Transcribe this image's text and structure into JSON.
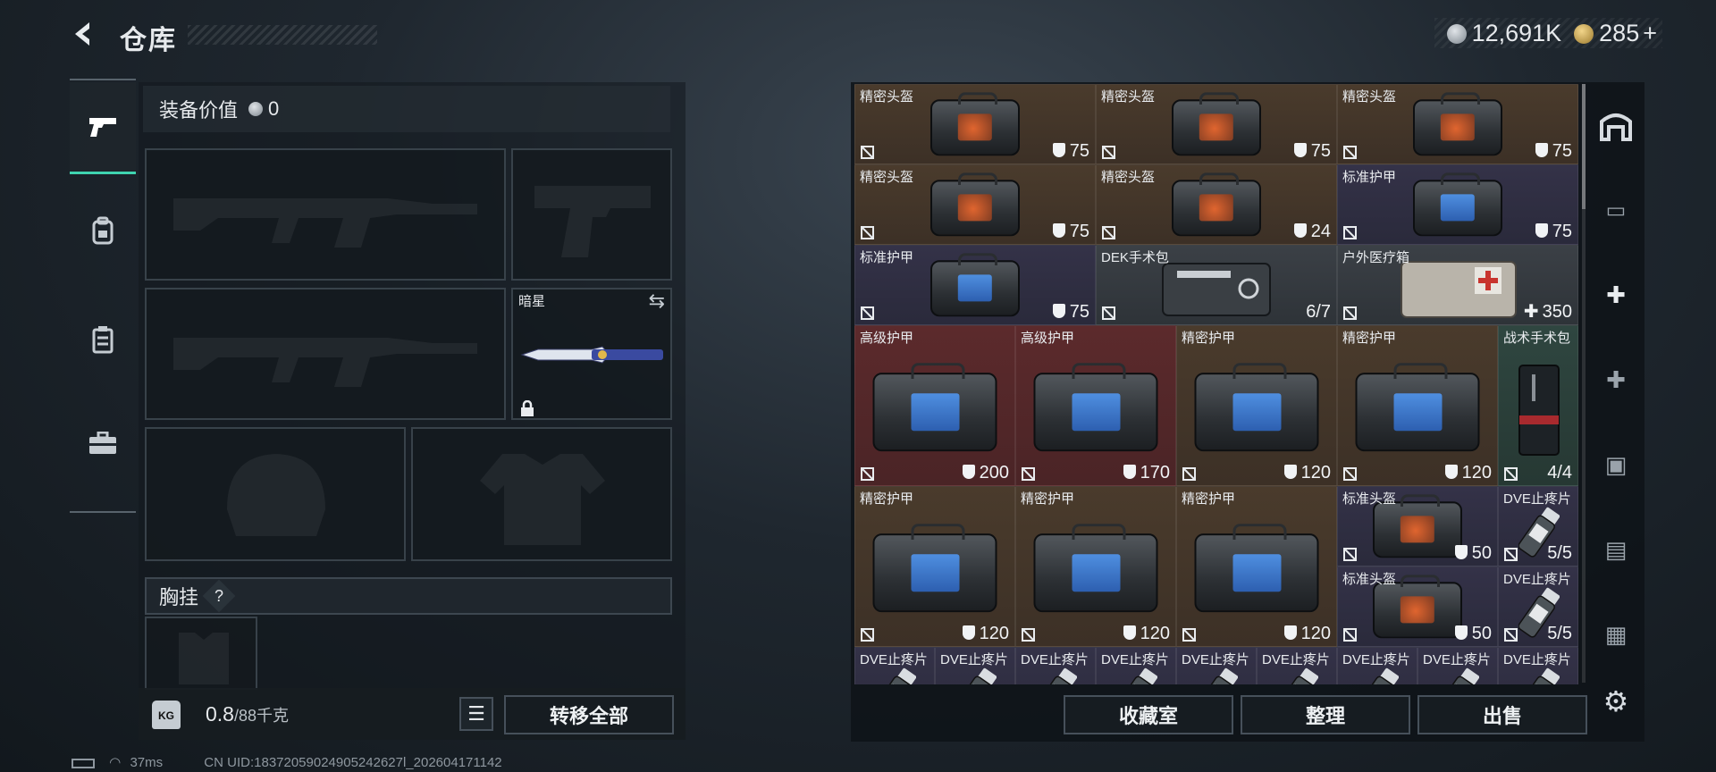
{
  "header": {
    "title": "仓库"
  },
  "currency": {
    "coins": "12,691K",
    "premium": "285",
    "premium_add": "+"
  },
  "equipment": {
    "value_label": "装备价值",
    "value": "0",
    "knife_name": "暗星",
    "chest_label": "胸挂",
    "chest_help": "?"
  },
  "footer": {
    "weight_current": "0.8",
    "weight_max": "/88千克",
    "weight_icon_text": "KG",
    "transfer_all": "转移全部",
    "collection": "收藏室",
    "organize": "整理",
    "sell": "出售"
  },
  "inventory": [
    {
      "name": "精密头盔",
      "value": "75",
      "kind": "shield",
      "color": "brown",
      "art": "helmet"
    },
    {
      "name": "精密头盔",
      "value": "75",
      "kind": "shield",
      "color": "brown",
      "art": "helmet"
    },
    {
      "name": "精密头盔",
      "value": "75",
      "kind": "shield",
      "color": "brown",
      "art": "helmet"
    },
    {
      "name": "精密头盔",
      "value": "75",
      "kind": "shield",
      "color": "brown",
      "art": "helmet"
    },
    {
      "name": "精密头盔",
      "value": "24",
      "kind": "shield",
      "color": "brown",
      "art": "helmet"
    },
    {
      "name": "标准护甲",
      "value": "75",
      "kind": "shield",
      "color": "purple",
      "art": "armor"
    },
    {
      "name": "标准护甲",
      "value": "75",
      "kind": "shield",
      "color": "purple",
      "art": "armor"
    },
    {
      "name": "DEK手术包",
      "value": "6/7",
      "kind": "count",
      "color": "gray",
      "art": "kit"
    },
    {
      "name": "户外医疗箱",
      "value": "350",
      "kind": "heal",
      "color": "gray",
      "art": "medbox"
    },
    {
      "name": "高级护甲",
      "value": "200",
      "kind": "shield",
      "color": "red",
      "art": "armor"
    },
    {
      "name": "高级护甲",
      "value": "170",
      "kind": "shield",
      "color": "red",
      "art": "armor"
    },
    {
      "name": "精密护甲",
      "value": "120",
      "kind": "shield",
      "color": "brown",
      "art": "armor"
    },
    {
      "name": "精密护甲",
      "value": "120",
      "kind": "shield",
      "color": "brown",
      "art": "armor"
    },
    {
      "name": "战术手术包",
      "value": "4/4",
      "kind": "count",
      "color": "green",
      "art": "tkit"
    },
    {
      "name": "精密护甲",
      "value": "120",
      "kind": "shield",
      "color": "brown",
      "art": "armor"
    },
    {
      "name": "精密护甲",
      "value": "120",
      "kind": "shield",
      "color": "brown",
      "art": "armor"
    },
    {
      "name": "精密护甲",
      "value": "120",
      "kind": "shield",
      "color": "brown",
      "art": "armor"
    },
    {
      "name": "标准头盔",
      "value": "50",
      "kind": "shield",
      "color": "purple",
      "art": "helmet"
    },
    {
      "name": "DVE止疼片",
      "value": "5/5",
      "kind": "count",
      "color": "purple",
      "art": "pill"
    },
    {
      "name": "标准头盔",
      "value": "50",
      "kind": "shield",
      "color": "purple",
      "art": "helmet"
    },
    {
      "name": "DVE止疼片",
      "value": "5/5",
      "kind": "count",
      "color": "purple",
      "art": "pill"
    },
    {
      "name": "DVE止疼片",
      "value": "",
      "kind": "count",
      "color": "purple",
      "art": "pill"
    },
    {
      "name": "DVE止疼片",
      "value": "",
      "kind": "count",
      "color": "purple",
      "art": "pill"
    },
    {
      "name": "DVE止疼片",
      "value": "",
      "kind": "count",
      "color": "purple",
      "art": "pill"
    },
    {
      "name": "DVE止疼片",
      "value": "",
      "kind": "count",
      "color": "purple",
      "art": "pill"
    },
    {
      "name": "DVE止疼片",
      "value": "",
      "kind": "count",
      "color": "purple",
      "art": "pill"
    },
    {
      "name": "DVE止疼片",
      "value": "",
      "kind": "count",
      "color": "purple",
      "art": "pill"
    },
    {
      "name": "DVE止疼片",
      "value": "",
      "kind": "count",
      "color": "purple",
      "art": "pill"
    },
    {
      "name": "DVE止疼片",
      "value": "",
      "kind": "count",
      "color": "purple",
      "art": "pill"
    },
    {
      "name": "DVE止疼片",
      "value": "",
      "kind": "count",
      "color": "purple",
      "art": "pill"
    }
  ],
  "status": {
    "ping": "37ms",
    "uid": "CN UID:18372059024905242627l_202604171142"
  }
}
